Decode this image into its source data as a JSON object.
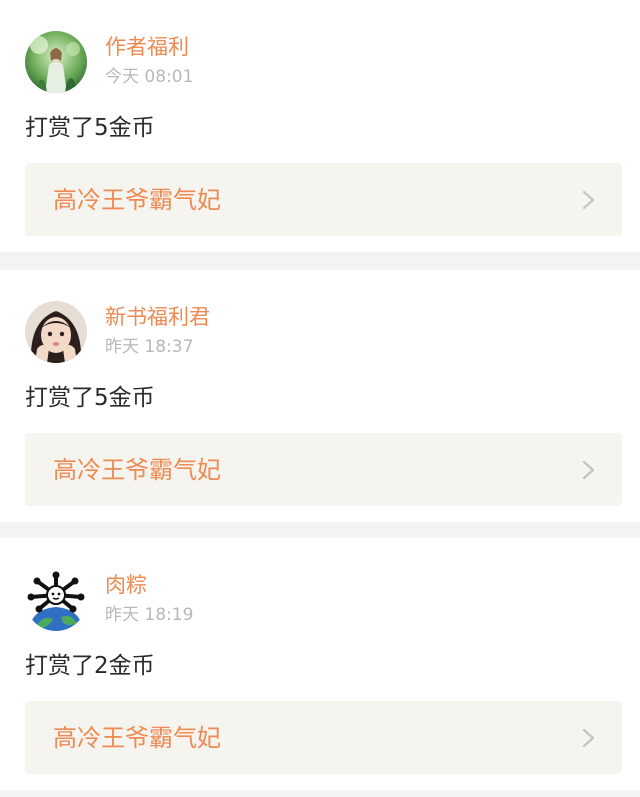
{
  "feed": {
    "items": [
      {
        "user_name": "作者福利",
        "time": "今天 08:01",
        "reward_text": "打赏了5金币",
        "book_title": "高冷王爷霸气妃",
        "avatar_icon": "avatar-girl-green-forest"
      },
      {
        "user_name": "新书福利君",
        "time": "昨天 18:37",
        "reward_text": "打赏了5金币",
        "book_title": "高冷王爷霸气妃",
        "avatar_icon": "avatar-girl-portrait"
      },
      {
        "user_name": "肉粽",
        "time": "昨天 18:19",
        "reward_text": "打赏了2金币",
        "book_title": "高冷王爷霸气妃",
        "avatar_icon": "avatar-cartoon-earth"
      }
    ]
  },
  "colors": {
    "accent": "#ee8a52",
    "text_primary": "#2b2b2b",
    "text_muted": "#b8b8b8",
    "link_bg": "#f5f4ef",
    "page_bg": "#f3f3f3"
  }
}
